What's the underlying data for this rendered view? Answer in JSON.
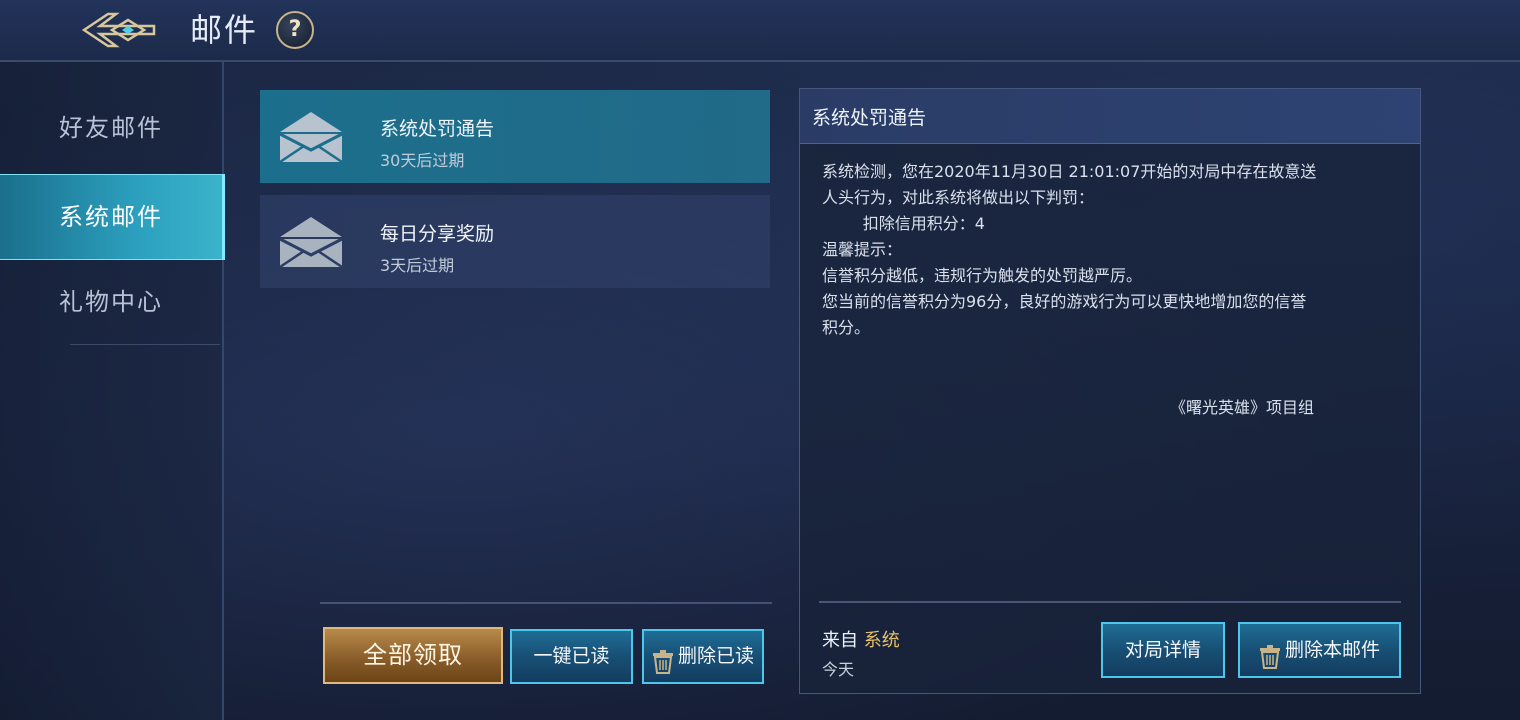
{
  "header": {
    "title": "邮件",
    "help_label": "?"
  },
  "sidebar": {
    "tabs": [
      {
        "label": "好友邮件",
        "active": false
      },
      {
        "label": "系统邮件",
        "active": true
      },
      {
        "label": "礼物中心",
        "active": false
      }
    ]
  },
  "mail_list": {
    "items": [
      {
        "title": "系统处罚通告",
        "expire": "30天后过期",
        "selected": true
      },
      {
        "title": "每日分享奖励",
        "expire": "3天后过期",
        "selected": false
      }
    ]
  },
  "list_actions": {
    "claim_all": "全部领取",
    "mark_all_read": "一键已读",
    "delete_read": "删除已读"
  },
  "detail": {
    "title": "系统处罚通告",
    "body_lines": [
      "系统检测，您在2020年11月30日 21:01:07开始的对局中存在故意送",
      "人头行为，对此系统将做出以下判罚：",
      "        扣除信用积分：4",
      "温馨提示：",
      "信誉积分越低，违规行为触发的处罚越严厉。",
      "您当前的信誉积分为96分，良好的游戏行为可以更快地增加您的信誉",
      "积分。"
    ],
    "signature": "《曙光英雄》项目组",
    "from_prefix": "来自",
    "from_value": "系统",
    "date": "今天",
    "match_detail": "对局详情",
    "delete_this": "删除本邮件"
  },
  "colors": {
    "accent_cyan": "#2b9fbd",
    "gold_button": "#8b5e2a",
    "sender_highlight": "#e6c16c"
  }
}
